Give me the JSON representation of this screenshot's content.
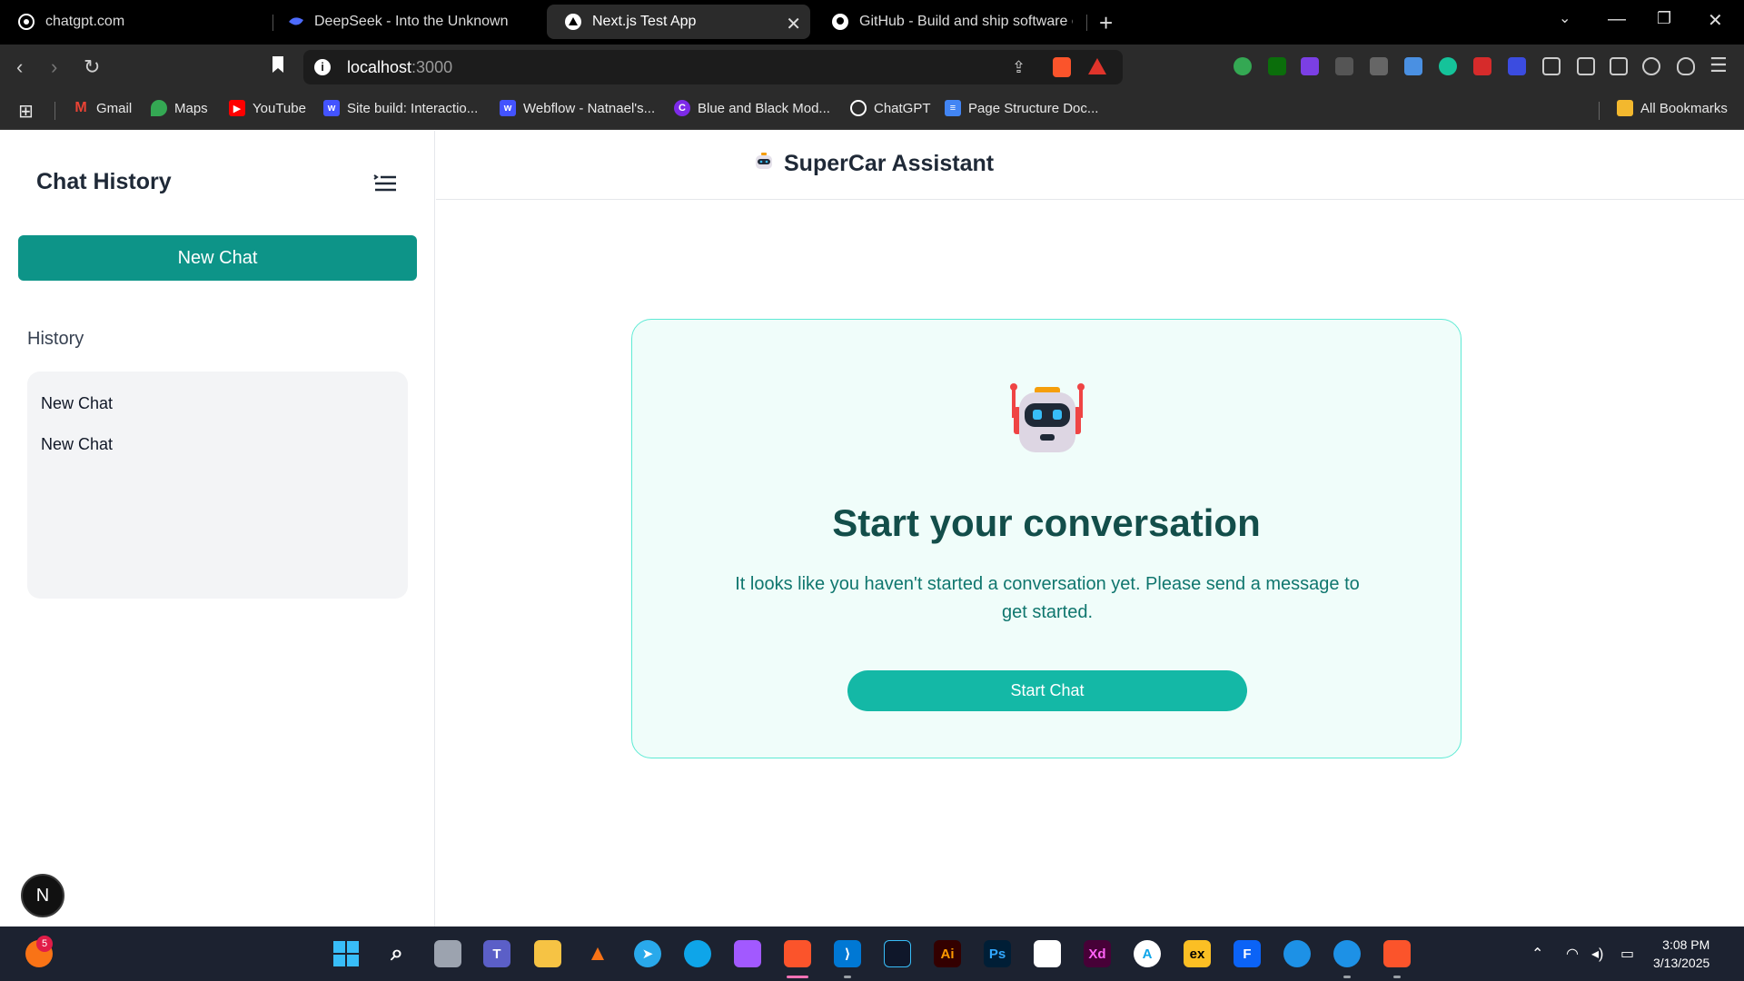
{
  "browser": {
    "tabs": [
      {
        "title": "chatgpt.com",
        "icon": "chatgpt-icon",
        "active": false
      },
      {
        "title": "DeepSeek - Into the Unknown",
        "icon": "deepseek-icon",
        "active": false
      },
      {
        "title": "Next.js Test App",
        "icon": "nextjs-icon",
        "active": true
      },
      {
        "title": "GitHub - Build and ship software on",
        "icon": "github-icon",
        "active": false
      }
    ],
    "address": {
      "host": "localhost",
      "port": ":3000"
    },
    "bookmarks": [
      {
        "label": "Gmail",
        "icon": "gmail-icon",
        "color": "#ea4335"
      },
      {
        "label": "Maps",
        "icon": "maps-icon",
        "color": "#34a853"
      },
      {
        "label": "YouTube",
        "icon": "youtube-icon",
        "color": "#ff0000"
      },
      {
        "label": "Site build: Interactio...",
        "icon": "webflow-icon",
        "color": "#4353ff"
      },
      {
        "label": "Webflow - Natnael's...",
        "icon": "webflow-icon",
        "color": "#4353ff"
      },
      {
        "label": "Blue and Black Mod...",
        "icon": "canva-icon",
        "color": "#7d2ae8"
      },
      {
        "label": "ChatGPT",
        "icon": "chatgpt-icon",
        "color": "#ffffff"
      },
      {
        "label": "Page Structure Doc...",
        "icon": "docs-icon",
        "color": "#4285f4"
      }
    ],
    "all_bookmarks": "All Bookmarks"
  },
  "sidebar": {
    "title": "Chat History",
    "new_chat": "New Chat",
    "history_label": "History",
    "history_items": [
      "New Chat",
      "New Chat"
    ],
    "badge": "N"
  },
  "header": {
    "title": "SuperCar Assistant"
  },
  "empty_state": {
    "heading": "Start your conversation",
    "message": "It looks like you haven't started a conversation yet. Please send a message to get started.",
    "button": "Start Chat"
  },
  "taskbar": {
    "notification_count": "5",
    "time": "3:08 PM",
    "date": "3/13/2025"
  },
  "colors": {
    "accent": "#0d9488",
    "button": "#14b8a6",
    "heading": "#134e4a",
    "card_bg": "#f0fdfa"
  }
}
